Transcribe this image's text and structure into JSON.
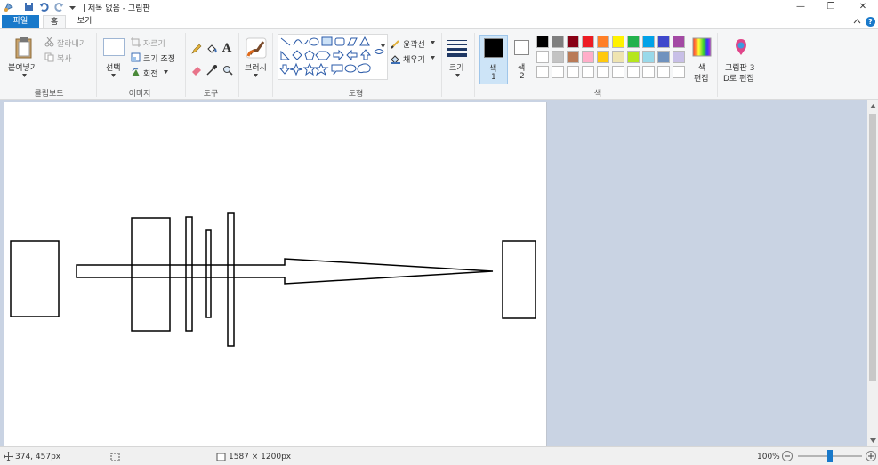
{
  "title_bar": {
    "title": "| 제목 없음 - 그림판",
    "minimize": "—",
    "restore": "❐",
    "close": "✕"
  },
  "tabs": {
    "file": "파일",
    "home": "홈",
    "view": "보기"
  },
  "ribbon": {
    "clipboard": {
      "paste": "붙여넣기",
      "cut": "잘라내기",
      "copy": "복사",
      "group": "클립보드"
    },
    "image": {
      "select": "선택",
      "crop": "자르기",
      "resize": "크기 조정",
      "rotate": "회전",
      "group": "이미지"
    },
    "tools": {
      "text_glyph": "A",
      "group": "도구"
    },
    "brushes": {
      "label": "브러시"
    },
    "shapes": {
      "outline": "윤곽선",
      "fill": "채우기",
      "group": "도형"
    },
    "size": {
      "label": "크기"
    },
    "colors": {
      "color1_label": "색",
      "color1_num": "1",
      "color2_label": "색",
      "color2_num": "2",
      "edit_line1": "색",
      "edit_line2": "편집",
      "group": "색",
      "palette_row1": [
        "#000000",
        "#7f7f7f",
        "#880015",
        "#ed1c24",
        "#ff7f27",
        "#fff200",
        "#22b14c",
        "#00a2e8",
        "#3f48cc",
        "#a349a4"
      ],
      "palette_row2": [
        "#ffffff",
        "#c3c3c3",
        "#b97a57",
        "#ffaec9",
        "#ffc90e",
        "#efe4b0",
        "#b5e61d",
        "#99d9ea",
        "#7092be",
        "#c8bfe7"
      ],
      "color1": "#000000",
      "color2": "#ffffff"
    },
    "paint3d": {
      "line1": "그림판 3",
      "line2": "D로 편집"
    }
  },
  "status": {
    "cursor_pos": "374, 457px",
    "canvas_size": "1587 × 1200px",
    "zoom": "100%",
    "zoom_level": 0.5
  }
}
